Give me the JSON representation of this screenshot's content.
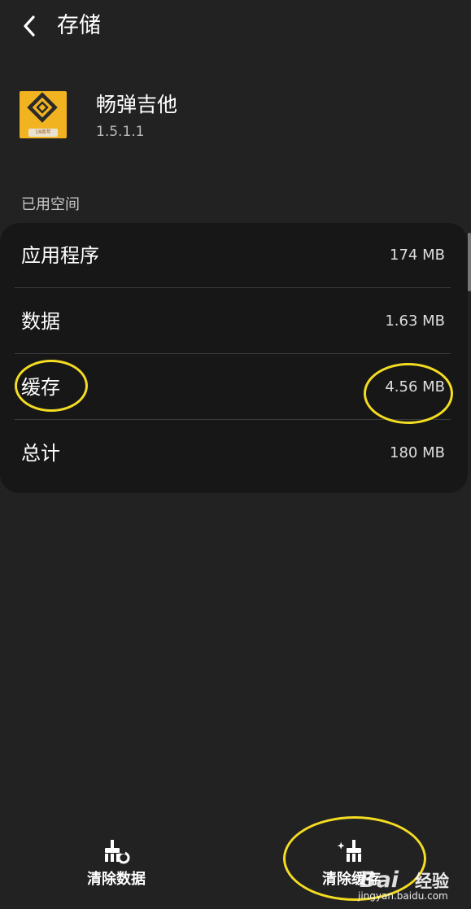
{
  "header": {
    "title": "存储",
    "back_icon": "chevron-left-icon"
  },
  "app": {
    "name": "畅弹吉他",
    "version": "1.5.1.1",
    "icon_tag": "18周年",
    "icon_color": "#f2b320"
  },
  "section": {
    "label": "已用空间"
  },
  "storage_rows": [
    {
      "label": "应用程序",
      "value": "174 MB"
    },
    {
      "label": "数据",
      "value": "1.63 MB"
    },
    {
      "label": "缓存",
      "value": "4.56 MB"
    },
    {
      "label": "总计",
      "value": "180 MB"
    }
  ],
  "actions": {
    "clear_data": {
      "label": "清除数据",
      "icon": "broom-clear-data-icon"
    },
    "clear_cache": {
      "label": "清除缓存",
      "icon": "broom-sparkle-icon"
    }
  },
  "watermark": {
    "logo": "Bai",
    "text": "经验",
    "url": "jingyan.baidu.com"
  },
  "colors": {
    "background": "#222222",
    "card": "#171717",
    "highlight": "#f3dc22"
  }
}
